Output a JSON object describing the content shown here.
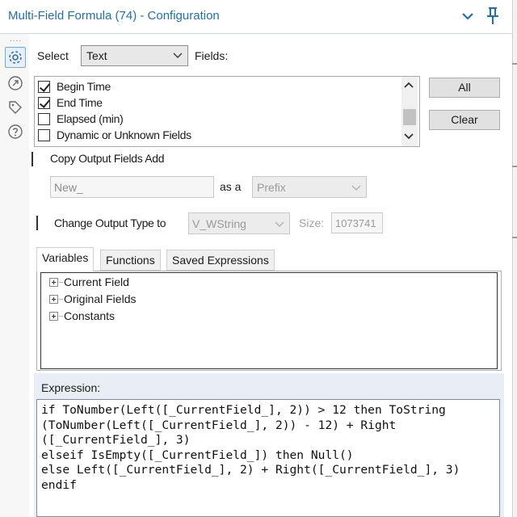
{
  "window": {
    "title": "Multi-Field Formula (74) - Configuration",
    "collapse_icon": "chevron-down-icon",
    "pin_icon": "pin-icon"
  },
  "rail": {
    "dots": "....",
    "icons": [
      "gear-icon",
      "navigate-icon",
      "tag-icon",
      "help-icon"
    ]
  },
  "select": {
    "label": "Select",
    "value": "Text",
    "fields_label": "Fields:"
  },
  "fields": [
    {
      "label": "Begin Time",
      "checked": true
    },
    {
      "label": "End Time",
      "checked": true
    },
    {
      "label": "Elapsed (min)",
      "checked": false
    },
    {
      "label": "Dynamic or Unknown Fields",
      "checked": false
    }
  ],
  "buttons": {
    "all": "All",
    "clear": "Clear"
  },
  "copy_output": {
    "label": "Copy Output Fields Add",
    "checked": false,
    "name_value": "New_",
    "as_a_label": "as a",
    "position_value": "Prefix"
  },
  "change_type": {
    "label": "Change Output Type to",
    "checked": false,
    "type_value": "V_WString",
    "size_label": "Size:",
    "size_value": "1073741"
  },
  "tabs": [
    {
      "label": "Variables",
      "active": true
    },
    {
      "label": "Functions",
      "active": false
    },
    {
      "label": "Saved Expressions",
      "active": false
    }
  ],
  "tree": [
    {
      "label": "Current Field"
    },
    {
      "label": "Original Fields"
    },
    {
      "label": "Constants"
    }
  ],
  "expression": {
    "label": "Expression:",
    "text": "if ToNumber(Left([_CurrentField_], 2)) > 12 then ToString\n(ToNumber(Left([_CurrentField_], 2)) - 12) + Right\n([_CurrentField_], 3)\nelseif IsEmpty([_CurrentField_]) then Null()\nelse Left([_CurrentField_], 2) + Right([_CurrentField_], 3)\nendif"
  },
  "colors": {
    "title": "#1f6fb7",
    "accent": "#1f6fb7",
    "expression_band": "#e9eef4"
  }
}
